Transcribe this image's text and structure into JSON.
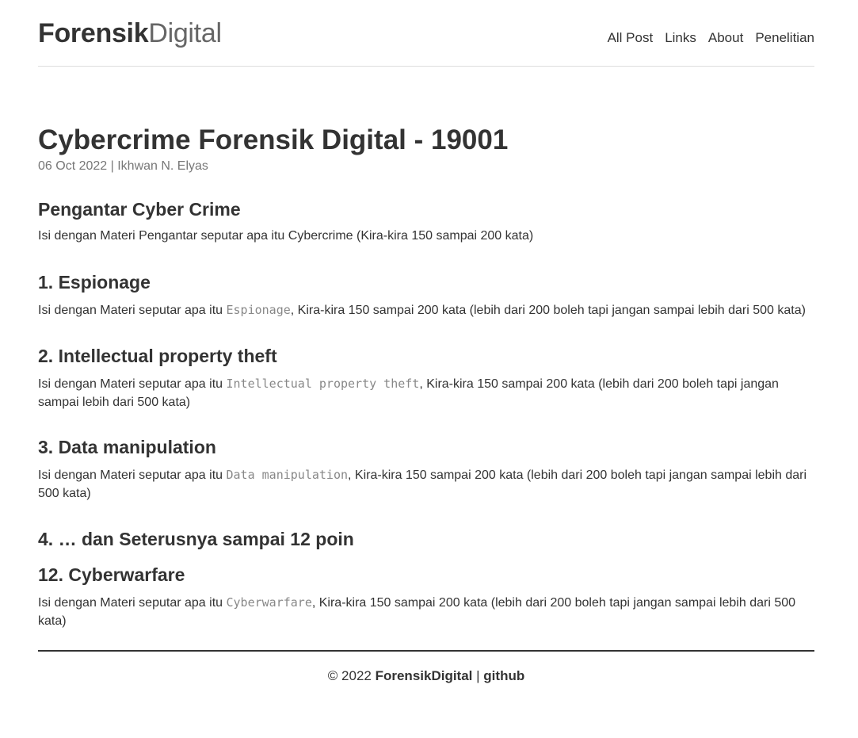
{
  "header": {
    "brand_bold": "Forensik",
    "brand_light": "Digital",
    "nav": [
      "All Post",
      "Links",
      "About",
      "Penelitian"
    ]
  },
  "post": {
    "title": "Cybercrime Forensik Digital - 19001",
    "meta": "06 Oct 2022 | Ikhwan N. Elyas",
    "intro": {
      "heading": "Pengantar Cyber Crime",
      "text": "Isi dengan Materi Pengantar seputar apa itu Cybercrime (Kira-kira 150 sampai 200 kata)"
    },
    "sections": [
      {
        "heading": "1. Espionage",
        "prefix": "Isi dengan Materi seputar apa itu ",
        "code": "Espionage",
        "suffix": ", Kira-kira 150 sampai 200 kata (lebih dari 200 boleh tapi jangan sampai lebih dari 500 kata)"
      },
      {
        "heading": "2. Intellectual property theft",
        "prefix": "Isi dengan Materi seputar apa itu ",
        "code": "Intellectual property theft",
        "suffix": ", Kira-kira 150 sampai 200 kata (lebih dari 200 boleh tapi jangan sampai lebih dari 500 kata)"
      },
      {
        "heading": "3. Data manipulation",
        "prefix": "Isi dengan Materi seputar apa itu ",
        "code": "Data manipulation",
        "suffix": ", Kira-kira 150 sampai 200 kata (lebih dari 200 boleh tapi jangan sampai lebih dari 500 kata)"
      }
    ],
    "ellipsis_heading": "4. … dan Seterusnya sampai 12 poin",
    "last_section": {
      "heading": "12. Cyberwarfare",
      "prefix": "Isi dengan Materi seputar apa itu ",
      "code": "Cyberwarfare",
      "suffix": ", Kira-kira 150 sampai 200 kata (lebih dari 200 boleh tapi jangan sampai lebih dari 500 kata)"
    }
  },
  "footer": {
    "copyright": "© 2022",
    "brand": "ForensikDigital",
    "separator": "|",
    "github": "github"
  }
}
